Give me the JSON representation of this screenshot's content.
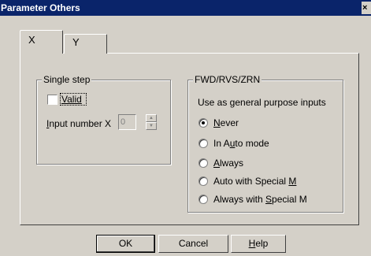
{
  "window": {
    "title": "Parameter Others",
    "close_label": "×"
  },
  "tabs": [
    {
      "label": "X",
      "selected": true
    },
    {
      "label": "Y",
      "selected": false
    }
  ],
  "single_step": {
    "legend": "Single step",
    "valid_label": "Valid",
    "valid_checked": false,
    "input_number_label": "Input number X",
    "input_number_value": "0"
  },
  "fwd_rvs_zrn": {
    "legend": "FWD/RVS/ZRN",
    "description": "Use as general purpose inputs",
    "options": [
      {
        "label": "Never",
        "mnemonic": "N",
        "rest": "ever",
        "selected": true
      },
      {
        "label": "In Auto mode",
        "pre": "In A",
        "mnemonic": "u",
        "rest": "to mode",
        "selected": false
      },
      {
        "label": "Always",
        "mnemonic": "A",
        "rest": "lways",
        "selected": false
      },
      {
        "label": "Auto with Special M",
        "pre": "Auto with Special ",
        "mnemonic": "M",
        "rest": "",
        "selected": false
      },
      {
        "label": "Always with Special M",
        "pre": "Always with ",
        "mnemonic": "S",
        "rest": "pecial M",
        "selected": false
      }
    ]
  },
  "buttons": {
    "ok": "OK",
    "cancel": "Cancel",
    "help_mnemonic": "H",
    "help_rest": "elp"
  }
}
